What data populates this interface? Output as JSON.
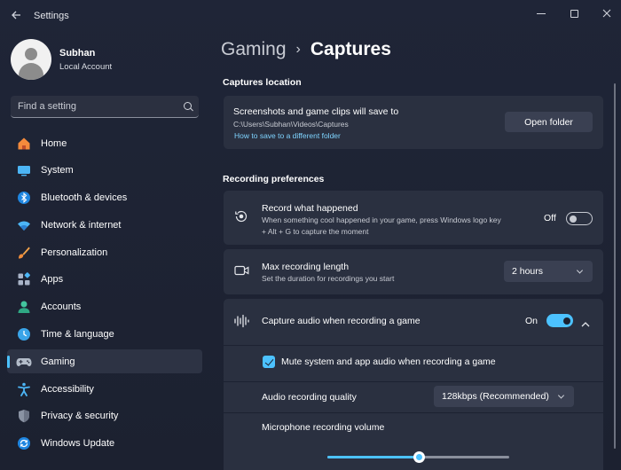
{
  "window": {
    "title": "Settings"
  },
  "profile": {
    "name": "Subhan",
    "account_type": "Local Account"
  },
  "search": {
    "placeholder": "Find a setting"
  },
  "sidebar": {
    "items": [
      {
        "label": "Home",
        "icon": "home-icon"
      },
      {
        "label": "System",
        "icon": "system-icon"
      },
      {
        "label": "Bluetooth & devices",
        "icon": "bluetooth-icon"
      },
      {
        "label": "Network & internet",
        "icon": "network-icon"
      },
      {
        "label": "Personalization",
        "icon": "personalization-icon"
      },
      {
        "label": "Apps",
        "icon": "apps-icon"
      },
      {
        "label": "Accounts",
        "icon": "accounts-icon"
      },
      {
        "label": "Time & language",
        "icon": "time-language-icon"
      },
      {
        "label": "Gaming",
        "icon": "gaming-icon",
        "active": true
      },
      {
        "label": "Accessibility",
        "icon": "accessibility-icon"
      },
      {
        "label": "Privacy & security",
        "icon": "privacy-icon"
      },
      {
        "label": "Windows Update",
        "icon": "windows-update-icon"
      }
    ]
  },
  "breadcrumb": {
    "parent": "Gaming",
    "separator": "›",
    "current": "Captures"
  },
  "captures_location": {
    "section_title": "Captures location",
    "title": "Screenshots and game clips will save to",
    "path": "C:\\Users\\Subhan\\Videos\\Captures",
    "link": "How to save to a different folder",
    "button": "Open folder"
  },
  "recording": {
    "section_title": "Recording preferences",
    "record_what_happened": {
      "title": "Record what happened",
      "description_line1": "When something cool happened in your game, press Windows logo key",
      "description_line2": "+ Alt + G to capture the moment",
      "state": "Off"
    },
    "max_length": {
      "title": "Max recording length",
      "description": "Set the duration for recordings you start",
      "value": "2 hours"
    },
    "capture_audio": {
      "title": "Capture audio when recording a game",
      "state": "On"
    },
    "mute_system": {
      "label": "Mute system and app audio when recording a game",
      "checked": true
    },
    "audio_quality": {
      "label": "Audio recording quality",
      "value": "128kbps (Recommended)"
    },
    "mic_volume": {
      "label": "Microphone recording volume",
      "level": 0.5
    }
  },
  "colors": {
    "accent": "#4cc2ff",
    "card": "#2a3040",
    "background": "#1d2333"
  }
}
